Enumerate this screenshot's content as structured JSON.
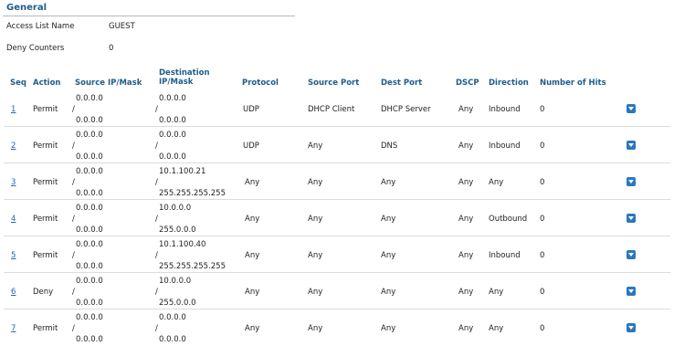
{
  "general": {
    "title": "General",
    "access_list_name_label": "Access List Name",
    "access_list_name_value": "GUEST",
    "deny_counters_label": "Deny Counters",
    "deny_counters_value": "0"
  },
  "table": {
    "headers": {
      "seq": "Seq",
      "action": "Action",
      "source_ip": "Source IP/Mask",
      "dest_ip_line1": "Destination",
      "dest_ip_line2": "IP/Mask",
      "protocol": "Protocol",
      "source_port": "Source Port",
      "dest_port": "Dest Port",
      "dscp": "DSCP",
      "direction": "Direction",
      "hits": "Number of Hits"
    },
    "ip_separator": "/",
    "rows": [
      {
        "seq": "1",
        "action": "Permit",
        "src_ip": "0.0.0.0",
        "src_mask": "0.0.0.0",
        "dst_ip": "0.0.0.0",
        "dst_mask": "0.0.0.0",
        "protocol": "UDP",
        "src_port": "DHCP Client",
        "dst_port": "DHCP Server",
        "dscp": "Any",
        "direction": "Inbound",
        "hits": "0"
      },
      {
        "seq": "2",
        "action": "Permit",
        "src_ip": "0.0.0.0",
        "src_mask": "0.0.0.0",
        "dst_ip": "0.0.0.0",
        "dst_mask": "0.0.0.0",
        "protocol": "UDP",
        "src_port": "Any",
        "dst_port": "DNS",
        "dscp": "Any",
        "direction": "Inbound",
        "hits": "0"
      },
      {
        "seq": "3",
        "action": "Permit",
        "src_ip": "0.0.0.0",
        "src_mask": "0.0.0.0",
        "dst_ip": "10.1.100.21",
        "dst_mask": "255.255.255.255",
        "protocol": "Any",
        "src_port": "Any",
        "dst_port": "Any",
        "dscp": "Any",
        "direction": "Any",
        "hits": "0"
      },
      {
        "seq": "4",
        "action": "Permit",
        "src_ip": "0.0.0.0",
        "src_mask": "0.0.0.0",
        "dst_ip": "10.0.0.0",
        "dst_mask": "255.0.0.0",
        "protocol": "Any",
        "src_port": "Any",
        "dst_port": "Any",
        "dscp": "Any",
        "direction": "Outbound",
        "hits": "0"
      },
      {
        "seq": "5",
        "action": "Permit",
        "src_ip": "0.0.0.0",
        "src_mask": "0.0.0.0",
        "dst_ip": "10.1.100.40",
        "dst_mask": "255.255.255.255",
        "protocol": "Any",
        "src_port": "Any",
        "dst_port": "Any",
        "dscp": "Any",
        "direction": "Inbound",
        "hits": "0"
      },
      {
        "seq": "6",
        "action": "Deny",
        "src_ip": "0.0.0.0",
        "src_mask": "0.0.0.0",
        "dst_ip": "10.0.0.0",
        "dst_mask": "255.0.0.0",
        "protocol": "Any",
        "src_port": "Any",
        "dst_port": "Any",
        "dscp": "Any",
        "direction": "Any",
        "hits": "0"
      },
      {
        "seq": "7",
        "action": "Permit",
        "src_ip": "0.0.0.0",
        "src_mask": "0.0.0.0",
        "dst_ip": "0.0.0.0",
        "dst_mask": "0.0.0.0",
        "protocol": "Any",
        "src_port": "Any",
        "dst_port": "Any",
        "dscp": "Any",
        "direction": "Any",
        "hits": "0"
      }
    ]
  },
  "colors": {
    "header": "#1f5c8a",
    "link": "#2266bb",
    "dropdown_button": "#2a77bf"
  },
  "icons": {
    "row_menu": "chevron-down-icon"
  }
}
